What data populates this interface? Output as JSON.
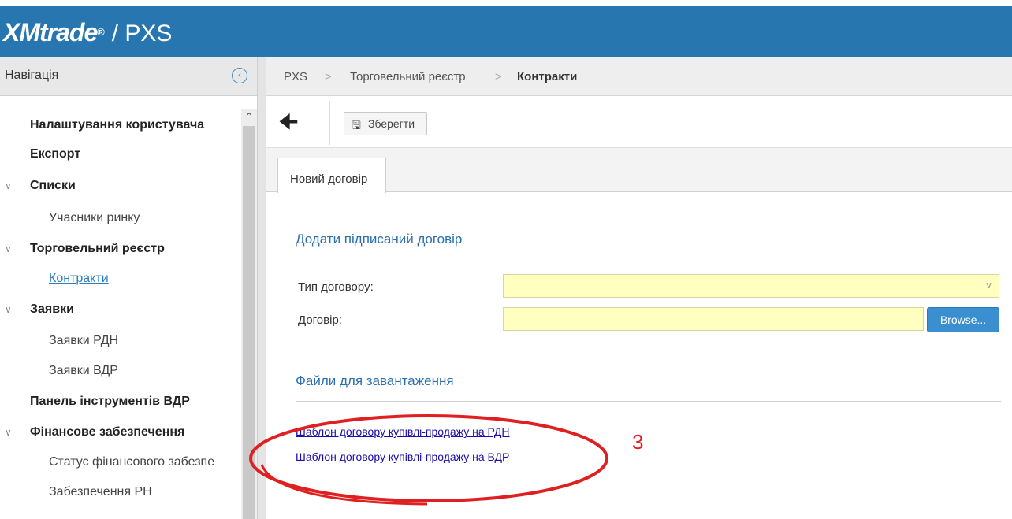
{
  "app": {
    "logo_brand": "XMtrade",
    "logo_reg": "®",
    "logo_product": "/ PXS"
  },
  "sidebar": {
    "title": "Навігація",
    "collapse_icon": "chevron-left-circle-icon",
    "items": [
      {
        "label": "Налаштування користувача"
      },
      {
        "label": "Експорт"
      },
      {
        "label": "Списки"
      },
      {
        "label": "Учасники ринку"
      },
      {
        "label": "Торговельний реєстр"
      },
      {
        "label": "Контракти"
      },
      {
        "label": "Заявки"
      },
      {
        "label": "Заявки РДН"
      },
      {
        "label": "Заявки ВДР"
      },
      {
        "label": "Панель інструментів ВДР"
      },
      {
        "label": "Фінансове забезпечення"
      },
      {
        "label": "Статус фінансового забезпе"
      },
      {
        "label": "Забезпечення РН"
      }
    ]
  },
  "breadcrumb": {
    "items": [
      "PXS",
      "Торговельний реєстр",
      "Контракти"
    ],
    "separator": ">"
  },
  "toolbar": {
    "back_icon": "arrow-left-icon",
    "save_label": "Зберегти",
    "save_icon": "floppy-disk-icon"
  },
  "tabs": [
    {
      "label": "Новий договір"
    }
  ],
  "form": {
    "section_title": "Додати підписаний договір",
    "contract_type_label": "Тип договору:",
    "contract_type_value": "",
    "contract_file_label": "Договір:",
    "contract_file_value": "",
    "browse_label": "Browse..."
  },
  "downloads": {
    "section_title": "Файли для завантаження",
    "links": [
      {
        "label": "Шаблон договору купівлі-продажу на РДН"
      },
      {
        "label": "Шаблон договору купівлі-продажу на ВДР"
      }
    ]
  },
  "annotation": {
    "number": "3",
    "color": "#e02020"
  },
  "colors": {
    "header_bg": "#2776b0",
    "field_highlight": "#ffffc0",
    "link": "#1a0dab",
    "accent": "#2c7cc0"
  }
}
